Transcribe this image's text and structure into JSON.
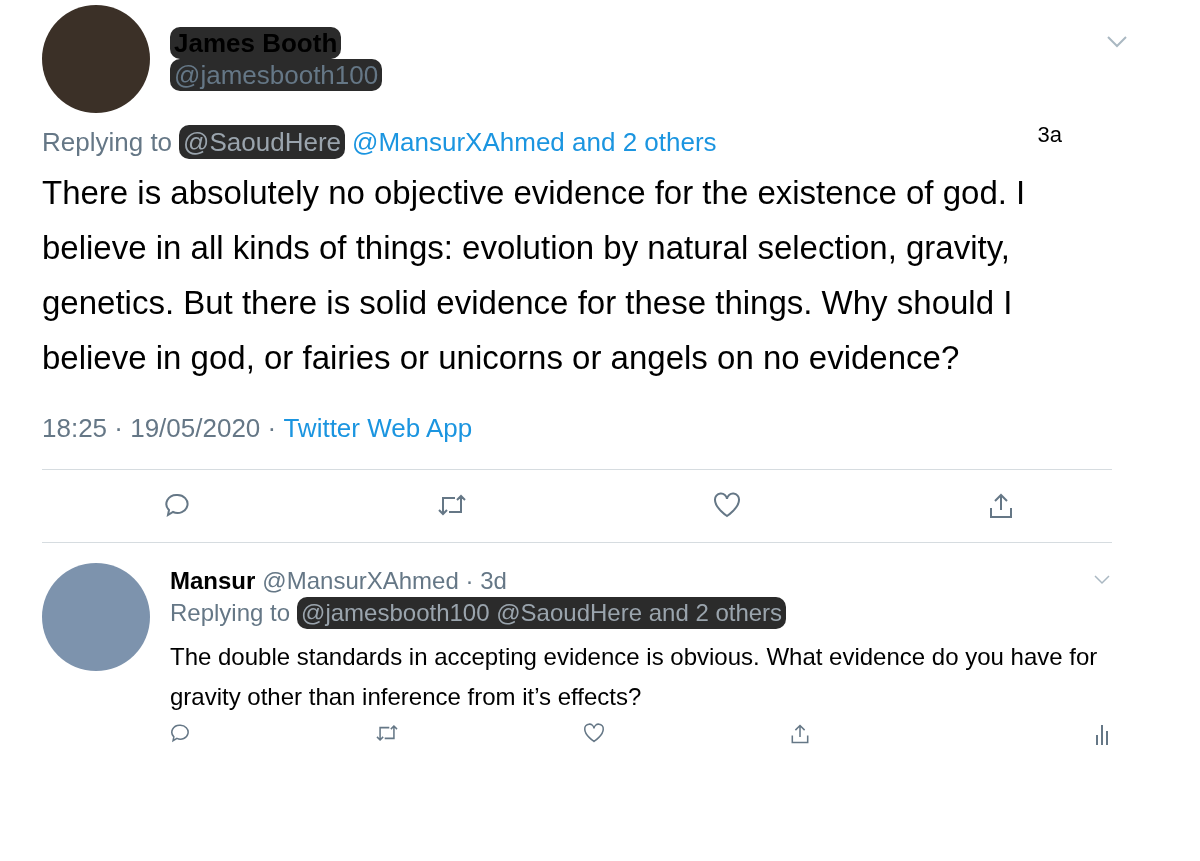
{
  "main_tweet": {
    "author_name": {
      "text": "James Booth",
      "redacted": true
    },
    "handle": {
      "text": "@jamesbooth100",
      "redacted": true
    },
    "replying_label": "Replying to",
    "replying_to": [
      {
        "text": "@SaoudHere",
        "redacted": true
      },
      {
        "text": "@MansurXAhmed and 2 others",
        "redacted": false
      }
    ],
    "annotation": "3a",
    "body": "There is absolutely no objective evidence for the existence of god. I believe in all kinds of things: evolution by natural selection, gravity, genetics. But there is solid evidence for these things. Why should I believe in god, or fairies or unicorns or angels on no evidence?",
    "timestamp": "18:25 · 19/05/2020 · ",
    "source": "Twitter Web App"
  },
  "reply": {
    "author_name": "Mansur",
    "handle": "@MansurXAhmed · 3d",
    "replying_label": "Replying to",
    "replying_to": [
      {
        "text": "@jamesbooth100 @SaoudHere and 2 others",
        "redacted": true
      }
    ],
    "body": "The double standards in accepting evidence is obvious. What evidence do you have for gravity other than inference from it’s effects?"
  }
}
